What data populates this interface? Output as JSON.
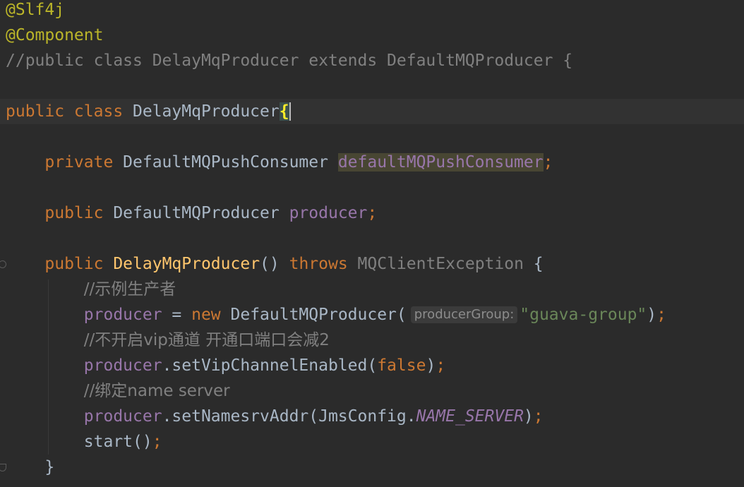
{
  "colors": {
    "background": "#2b2b2b",
    "current_line": "#323232",
    "keyword": "#cc7832",
    "annotation": "#bbb529",
    "comment": "#808080",
    "field": "#9876aa",
    "method_declaration": "#ffc66d",
    "string": "#6a8759",
    "plain": "#a9b7c6"
  },
  "lines": [
    {
      "t": [
        {
          "c": "annotation",
          "v": "@Slf4j"
        }
      ]
    },
    {
      "t": [
        {
          "c": "annotation",
          "v": "@Component"
        }
      ]
    },
    {
      "t": [
        {
          "c": "comment",
          "v": "//public class DelayMqProducer extends DefaultMQProducer {"
        }
      ]
    },
    {
      "t": []
    },
    {
      "t": [
        {
          "c": "keyword",
          "v": "public class "
        },
        {
          "c": "plain",
          "v": "DelayMqProducer"
        },
        {
          "c": "brace-match",
          "v": "{"
        }
      ]
    },
    {
      "t": []
    },
    {
      "t": [
        {
          "c": "plain",
          "v": "    "
        },
        {
          "c": "keyword",
          "v": "private "
        },
        {
          "c": "plain",
          "v": "DefaultMQPushConsumer "
        },
        {
          "c": "field-hl",
          "v": "defaultMQPushConsumer"
        },
        {
          "c": "keyword",
          "v": ";"
        }
      ]
    },
    {
      "t": []
    },
    {
      "t": [
        {
          "c": "plain",
          "v": "    "
        },
        {
          "c": "keyword",
          "v": "public "
        },
        {
          "c": "plain",
          "v": "DefaultMQProducer "
        },
        {
          "c": "field",
          "v": "producer"
        },
        {
          "c": "keyword",
          "v": ";"
        }
      ]
    },
    {
      "t": []
    },
    {
      "t": [
        {
          "c": "plain",
          "v": "    "
        },
        {
          "c": "keyword",
          "v": "public "
        },
        {
          "c": "method",
          "v": "DelayMqProducer"
        },
        {
          "c": "plain",
          "v": "() "
        },
        {
          "c": "keyword",
          "v": "throws "
        },
        {
          "c": "dim",
          "v": "MQClientException "
        },
        {
          "c": "plain",
          "v": "{"
        }
      ]
    },
    {
      "t": [
        {
          "c": "plain",
          "v": "        "
        },
        {
          "c": "comment-cn",
          "v": "//示例生产者"
        }
      ]
    },
    {
      "t": [
        {
          "c": "plain",
          "v": "        "
        },
        {
          "c": "field",
          "v": "producer"
        },
        {
          "c": "plain",
          "v": " = "
        },
        {
          "c": "keyword",
          "v": "new "
        },
        {
          "c": "plain",
          "v": "DefaultMQProducer("
        },
        {
          "c": "hint",
          "v": "producerGroup:"
        },
        {
          "c": "string",
          "v": "\"guava-group\""
        },
        {
          "c": "plain",
          "v": ")"
        },
        {
          "c": "keyword",
          "v": ";"
        }
      ]
    },
    {
      "t": [
        {
          "c": "plain",
          "v": "        "
        },
        {
          "c": "comment-cn",
          "v": "//不开启vip通道 开通口端口会减2"
        }
      ]
    },
    {
      "t": [
        {
          "c": "plain",
          "v": "        "
        },
        {
          "c": "field",
          "v": "producer"
        },
        {
          "c": "plain",
          "v": ".setVipChannelEnabled("
        },
        {
          "c": "keyword",
          "v": "false"
        },
        {
          "c": "plain",
          "v": ")"
        },
        {
          "c": "keyword",
          "v": ";"
        }
      ]
    },
    {
      "t": [
        {
          "c": "plain",
          "v": "        "
        },
        {
          "c": "comment-cn",
          "v": "//绑定name server"
        }
      ]
    },
    {
      "t": [
        {
          "c": "plain",
          "v": "        "
        },
        {
          "c": "field",
          "v": "producer"
        },
        {
          "c": "plain",
          "v": ".setNamesrvAddr(JmsConfig."
        },
        {
          "c": "const",
          "v": "NAME_SERVER"
        },
        {
          "c": "plain",
          "v": ")"
        },
        {
          "c": "keyword",
          "v": ";"
        }
      ]
    },
    {
      "t": [
        {
          "c": "plain",
          "v": "        "
        },
        {
          "c": "plain",
          "v": "start()"
        },
        {
          "c": "keyword",
          "v": ";"
        }
      ]
    },
    {
      "t": [
        {
          "c": "plain",
          "v": "    }"
        }
      ]
    }
  ]
}
